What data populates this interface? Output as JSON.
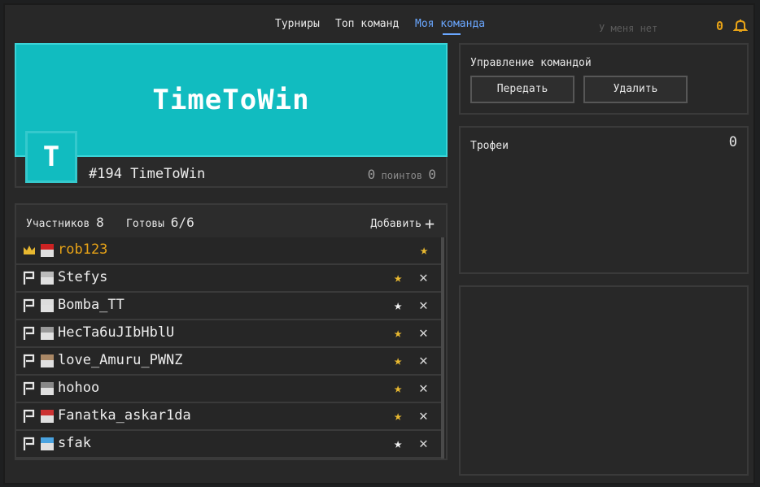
{
  "nav": {
    "items": [
      {
        "label": "Турниры",
        "active": false
      },
      {
        "label": "Топ команд",
        "active": false
      },
      {
        "label": "Моя команда",
        "active": true
      }
    ],
    "ghost_text": "У меня нет",
    "notifications_count": "0",
    "accent_color": "#6aa7ff",
    "bell_icon": "bell-icon"
  },
  "team": {
    "banner_name": "TimeToWin",
    "avatar_letter": "T",
    "rank_name": "#194 TimeToWin",
    "points_value": "0",
    "points_label": "поинтов",
    "points_value2": "0",
    "banner_color": "#11bcc0"
  },
  "members": {
    "members_label": "Участников",
    "members_count": "8",
    "ready_label": "Готовы",
    "ready_count": "6/6",
    "add_label": "Добавить",
    "list": [
      {
        "role": "crown",
        "nick": "rob123",
        "star": "gold",
        "kick": false
      },
      {
        "role": "flag",
        "nick": "Stefys",
        "star": "gold",
        "kick": true
      },
      {
        "role": "flag",
        "nick": "Bomba_TT",
        "star": "white",
        "kick": true
      },
      {
        "role": "flag",
        "nick": "HecTa6uJIbHblU",
        "star": "gold",
        "kick": true
      },
      {
        "role": "flag",
        "nick": "love_Amuru_PWNZ",
        "star": "gold",
        "kick": true
      },
      {
        "role": "flag",
        "nick": "hohoo",
        "star": "gold",
        "kick": true
      },
      {
        "role": "flag",
        "nick": "Fanatka_askar1da",
        "star": "gold",
        "kick": true
      },
      {
        "role": "flag",
        "nick": "sfak",
        "star": "white",
        "kick": true
      }
    ]
  },
  "management": {
    "title": "Управление командой",
    "transfer_label": "Передать",
    "delete_label": "Удалить"
  },
  "trophies": {
    "title": "Трофеи",
    "count": "0"
  },
  "colors": {
    "gold": "#e8b830",
    "owner_nick": "#e8a317"
  }
}
